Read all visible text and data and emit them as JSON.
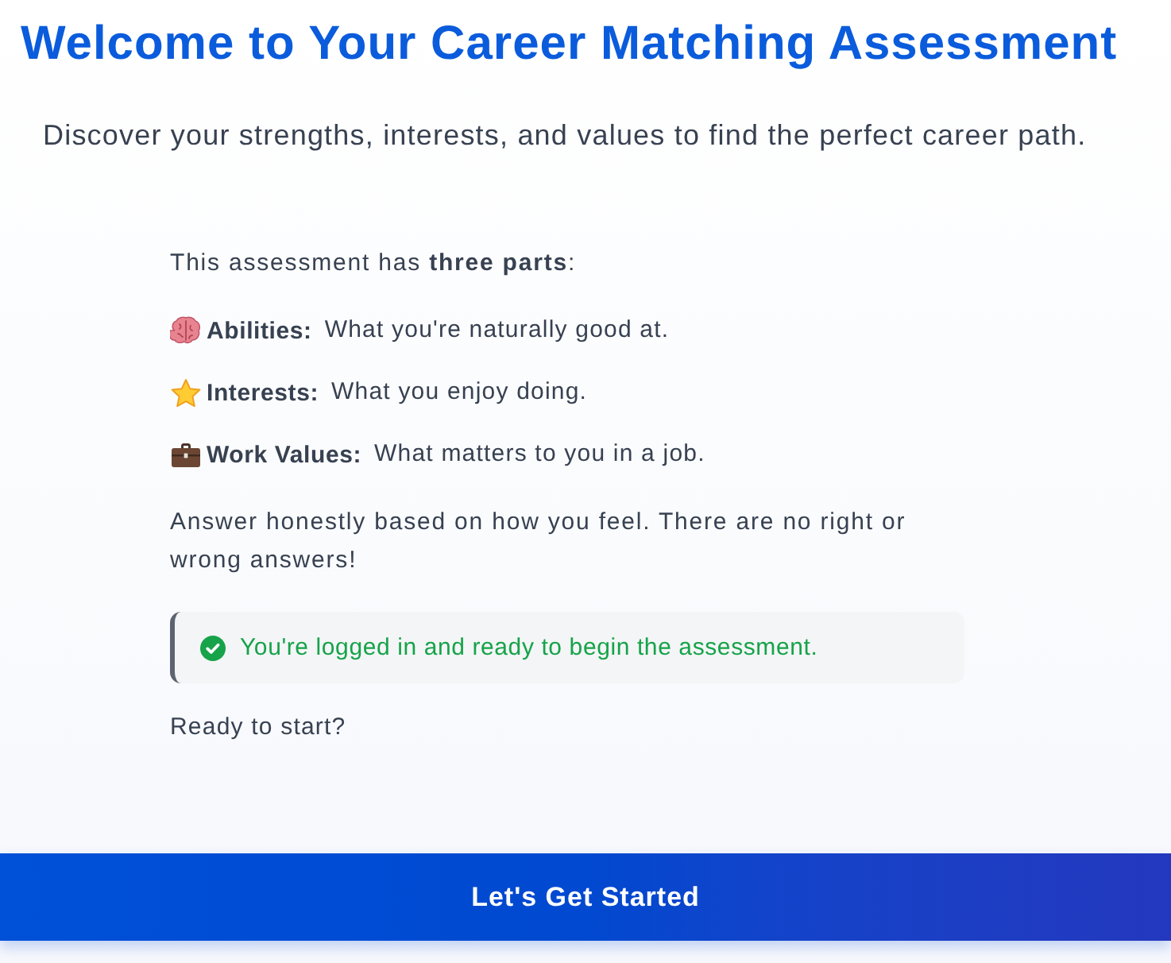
{
  "title": "Welcome to Your Career Matching Assessment",
  "subtitle": "Discover your strengths, interests, and values to find the perfect career path.",
  "intro": "This assessment has **three parts**:",
  "parts": [
    {
      "kind": "abilities",
      "label": "Abilities:",
      "description": "What you're naturally good at."
    },
    {
      "kind": "interests",
      "label": "Interests:",
      "description": "What you enjoy doing."
    },
    {
      "kind": "values",
      "label": "Work Values:",
      "description": "What matters to you in a job."
    }
  ],
  "note": "Answer honestly based on how you feel. There are no right or wrong answers!",
  "status": {
    "kind": "success",
    "text": "You're logged in and ready to begin the assessment."
  },
  "prompt": "Ready to start?",
  "start_button": {
    "label": "Let's Get Started"
  }
}
